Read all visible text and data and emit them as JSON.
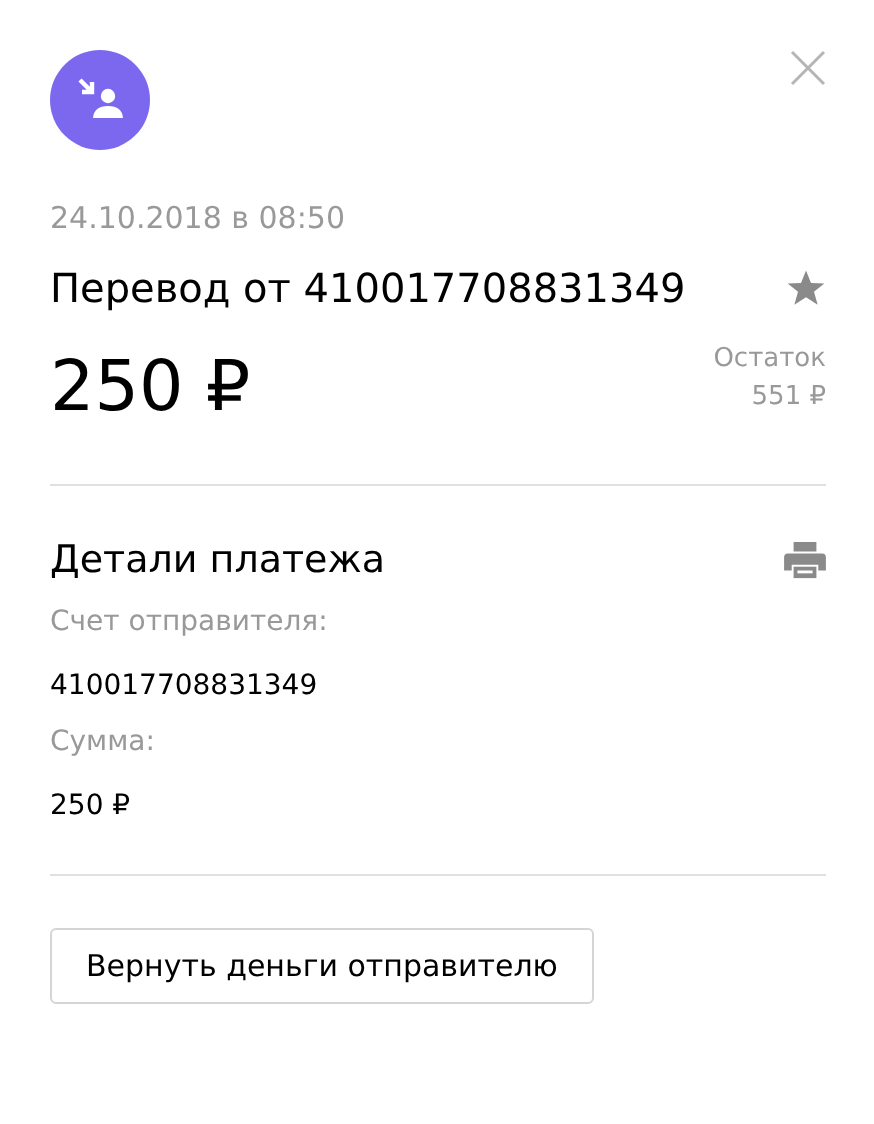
{
  "header": {
    "date": "24.10.2018 в 08:50",
    "title": "Перевод от 410017708831349",
    "favorite": false,
    "amount": "250 ₽",
    "balance_label": "Остаток",
    "balance": "551 ₽"
  },
  "details": {
    "title": "Детали платежа",
    "fields": [
      {
        "label": "Счет отправителя:",
        "value": "410017708831349"
      },
      {
        "label": "Сумма:",
        "value": "250 ₽"
      }
    ]
  },
  "button": "Вернуть деньги отправителю"
}
